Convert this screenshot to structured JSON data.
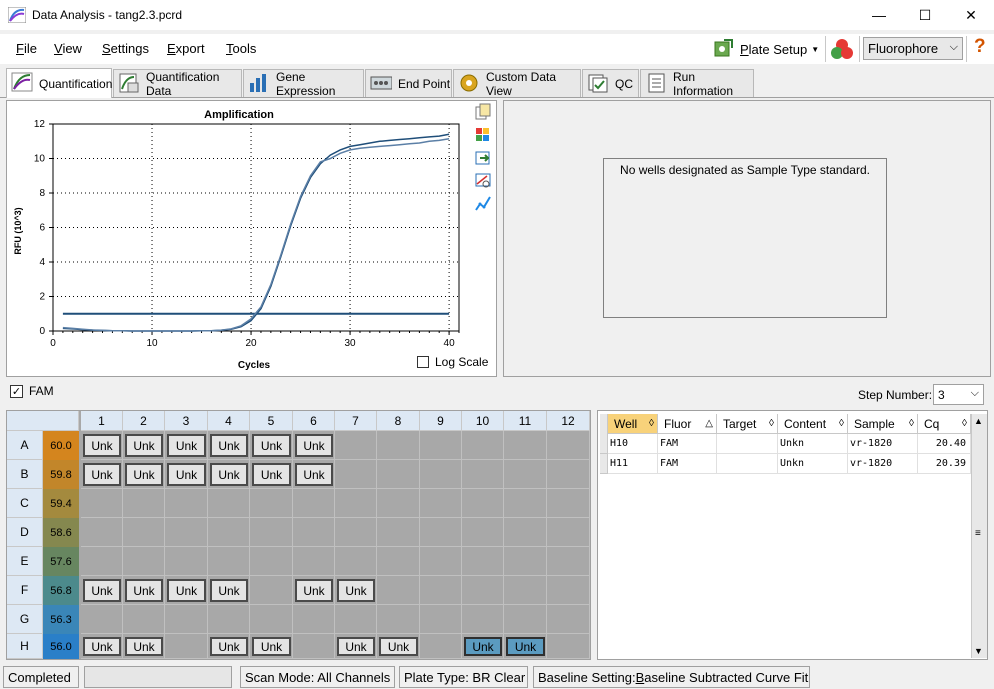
{
  "window": {
    "title": "Data Analysis - tang2.3.pcrd",
    "min": "—",
    "max": "☐",
    "close": "✕"
  },
  "menu": [
    {
      "key": "F",
      "rest": "ile"
    },
    {
      "key": "V",
      "rest": "iew"
    },
    {
      "key": "S",
      "rest": "ettings"
    },
    {
      "key": "E",
      "rest": "xport"
    },
    {
      "key": "T",
      "rest": "ools"
    }
  ],
  "toolbar": {
    "plate_setup_key": "P",
    "plate_setup_rest": "late Setup",
    "fluor_select": "Fluorophore",
    "help": "?"
  },
  "tabs": [
    {
      "label": "Quantification",
      "icon": "amplification-icon"
    },
    {
      "label": "Quantification Data",
      "icon": "data-sheet-icon"
    },
    {
      "label": "Gene Expression",
      "icon": "bar-chart-icon"
    },
    {
      "label": "End Point",
      "icon": "end-point-icon"
    },
    {
      "label": "Custom Data View",
      "icon": "gear-icon"
    },
    {
      "label": "QC",
      "icon": "qc-check-icon"
    },
    {
      "label": "Run Information",
      "icon": "document-icon"
    }
  ],
  "chart_data": {
    "type": "line",
    "title": "Amplification",
    "xlabel": "Cycles",
    "ylabel": "RFU (10^3)",
    "xlim": [
      0,
      41
    ],
    "ylim": [
      0,
      12
    ],
    "xticks": [
      0,
      10,
      20,
      30,
      40
    ],
    "yticks": [
      0,
      2,
      4,
      6,
      8,
      10,
      12
    ],
    "grid": true,
    "log_scale_label": "Log Scale",
    "log_scale_checked": false,
    "threshold": 1.0,
    "series": [
      {
        "color": "#1f4e79",
        "x": [
          1,
          2,
          3,
          4,
          5,
          6,
          7,
          8,
          9,
          10,
          11,
          12,
          13,
          14,
          15,
          16,
          17,
          18,
          19,
          20,
          21,
          22,
          23,
          24,
          25,
          26,
          27,
          28,
          29,
          30,
          31,
          32,
          33,
          34,
          35,
          36,
          37,
          38,
          39,
          40
        ],
        "y": [
          0.15,
          0.12,
          0.08,
          0.05,
          0.03,
          0.02,
          0.01,
          0.0,
          0.0,
          0.0,
          0.0,
          0.0,
          0.0,
          0.0,
          0.01,
          0.02,
          0.04,
          0.1,
          0.25,
          0.6,
          1.3,
          2.6,
          4.3,
          6.1,
          7.7,
          8.9,
          9.7,
          10.2,
          10.5,
          10.7,
          10.8,
          10.9,
          11.0,
          11.05,
          11.1,
          11.15,
          11.2,
          11.25,
          11.3,
          11.4
        ]
      },
      {
        "color": "#5b7fa6",
        "x": [
          1,
          2,
          3,
          4,
          5,
          6,
          7,
          8,
          9,
          10,
          11,
          12,
          13,
          14,
          15,
          16,
          17,
          18,
          19,
          20,
          21,
          22,
          23,
          24,
          25,
          26,
          27,
          28,
          29,
          30,
          31,
          32,
          33,
          34,
          35,
          36,
          37,
          38,
          39,
          40
        ],
        "y": [
          0.2,
          0.15,
          0.1,
          0.06,
          0.04,
          0.02,
          0.01,
          0.0,
          0.0,
          0.0,
          0.0,
          0.0,
          0.0,
          0.0,
          0.01,
          0.02,
          0.05,
          0.12,
          0.3,
          0.7,
          1.4,
          2.7,
          4.4,
          6.2,
          7.8,
          9.0,
          9.8,
          10.0,
          10.3,
          10.5,
          10.6,
          10.65,
          10.7,
          10.75,
          10.8,
          10.85,
          10.9,
          11.0,
          11.05,
          11.15
        ]
      }
    ]
  },
  "standard_message": "No wells designated as Sample Type standard.",
  "fluor_checkbox": {
    "label": "FAM",
    "checked": true
  },
  "step": {
    "label": "Step Number:",
    "value": "3"
  },
  "plate": {
    "cols": [
      "1",
      "2",
      "3",
      "4",
      "5",
      "6",
      "7",
      "8",
      "9",
      "10",
      "11",
      "12"
    ],
    "rows": [
      "A",
      "B",
      "C",
      "D",
      "E",
      "F",
      "G",
      "H"
    ],
    "temps": [
      "60.0",
      "59.8",
      "59.4",
      "58.6",
      "57.6",
      "56.8",
      "56.3",
      "56.0"
    ],
    "temp_colors": [
      "#d4851e",
      "#c2862a",
      "#a48a3e",
      "#85884f",
      "#678660",
      "#4c8a8c",
      "#3a86b8",
      "#2a7fc8"
    ],
    "wells": {
      "A": [
        1,
        2,
        3,
        4,
        5,
        6
      ],
      "B": [
        1,
        2,
        3,
        4,
        5,
        6
      ],
      "C": [],
      "D": [],
      "E": [],
      "F": [
        1,
        2,
        3,
        4,
        6,
        7
      ],
      "G": [],
      "H": [
        1,
        2,
        4,
        5,
        7,
        8,
        10,
        11
      ]
    },
    "selected": {
      "H": [
        10,
        11
      ]
    },
    "well_label": "Unk"
  },
  "table": {
    "headers": [
      "Well",
      "Fluor",
      "Target",
      "Content",
      "Sample",
      "Cq"
    ],
    "rows": [
      [
        "H10",
        "FAM",
        "",
        "Unkn",
        "vr-1820",
        "20.40"
      ],
      [
        "H11",
        "FAM",
        "",
        "Unkn",
        "vr-1820",
        "20.39"
      ]
    ]
  },
  "status": {
    "state": "Completed",
    "scan_mode": "Scan Mode: All Channels",
    "plate_type": "Plate Type: BR Clear",
    "baseline_prefix": "Baseline Setting: ",
    "baseline_key": "B",
    "baseline_rest": "aseline Subtracted Curve Fit"
  }
}
